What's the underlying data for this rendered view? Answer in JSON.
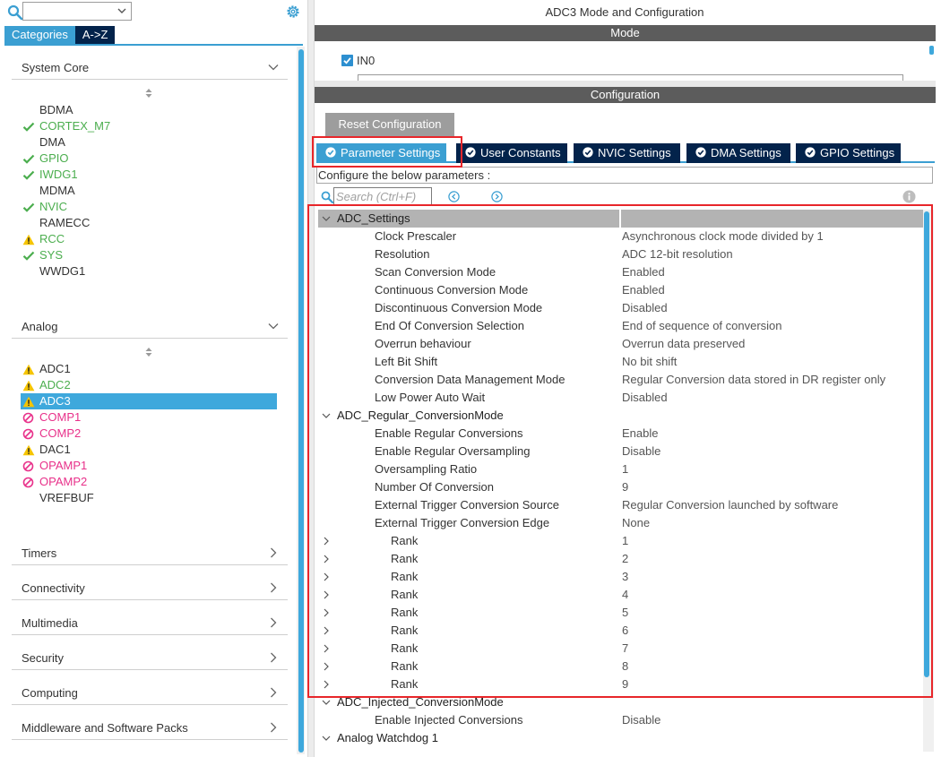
{
  "left_panel": {
    "search_icon": "search-icon",
    "combo_value": "",
    "gear_icon": "gear-icon",
    "tabs": [
      {
        "label": "Categories",
        "active": true
      },
      {
        "label": "A->Z",
        "active": false
      }
    ],
    "sections": [
      {
        "label": "System Core",
        "expanded": true,
        "items": [
          {
            "label": "BDMA",
            "status": "none"
          },
          {
            "label": "CORTEX_M7",
            "status": "ok"
          },
          {
            "label": "DMA",
            "status": "none"
          },
          {
            "label": "GPIO",
            "status": "ok"
          },
          {
            "label": "IWDG1",
            "status": "ok"
          },
          {
            "label": "MDMA",
            "status": "none"
          },
          {
            "label": "NVIC",
            "status": "ok"
          },
          {
            "label": "RAMECC",
            "status": "none"
          },
          {
            "label": "RCC",
            "status": "warning"
          },
          {
            "label": "SYS",
            "status": "ok"
          },
          {
            "label": "WWDG1",
            "status": "none"
          }
        ]
      },
      {
        "label": "Analog",
        "expanded": true,
        "items": [
          {
            "label": "ADC1",
            "status": "warning-text"
          },
          {
            "label": "ADC2",
            "status": "warning"
          },
          {
            "label": "ADC3",
            "status": "warning-selected"
          },
          {
            "label": "COMP1",
            "status": "disabled"
          },
          {
            "label": "COMP2",
            "status": "disabled"
          },
          {
            "label": "DAC1",
            "status": "warning-text"
          },
          {
            "label": "OPAMP1",
            "status": "disabled"
          },
          {
            "label": "OPAMP2",
            "status": "disabled"
          },
          {
            "label": "VREFBUF",
            "status": "none"
          }
        ]
      },
      {
        "label": "Timers",
        "expanded": false
      },
      {
        "label": "Connectivity",
        "expanded": false
      },
      {
        "label": "Multimedia",
        "expanded": false
      },
      {
        "label": "Security",
        "expanded": false
      },
      {
        "label": "Computing",
        "expanded": false
      },
      {
        "label": "Middleware and Software Packs",
        "expanded": false
      }
    ]
  },
  "right_panel": {
    "title": "ADC3 Mode and Configuration",
    "mode_bar": "Mode",
    "mode_checkbox_label": "IN0",
    "mode_checkbox_checked": true,
    "config_bar": "Configuration",
    "reset_button": "Reset Configuration",
    "tabs": [
      {
        "label": "Parameter Settings",
        "active": true
      },
      {
        "label": "User Constants",
        "active": false
      },
      {
        "label": "NVIC Settings",
        "active": false
      },
      {
        "label": "DMA Settings",
        "active": false
      },
      {
        "label": "GPIO Settings",
        "active": false
      }
    ],
    "configure_text": "Configure the below parameters :",
    "search_placeholder": "Search (Ctrl+F)",
    "rows": [
      {
        "type": "group",
        "name": "ADC_Settings",
        "expanded": true,
        "highlight": true
      },
      {
        "type": "param",
        "name": "Clock Prescaler",
        "value": "Asynchronous clock mode divided by 1"
      },
      {
        "type": "param",
        "name": "Resolution",
        "value": "ADC 12-bit resolution"
      },
      {
        "type": "param",
        "name": "Scan Conversion Mode",
        "value": "Enabled"
      },
      {
        "type": "param",
        "name": "Continuous Conversion Mode",
        "value": "Enabled"
      },
      {
        "type": "param",
        "name": "Discontinuous Conversion Mode",
        "value": "Disabled"
      },
      {
        "type": "param",
        "name": "End Of Conversion Selection",
        "value": "End of sequence of conversion"
      },
      {
        "type": "param",
        "name": "Overrun behaviour",
        "value": "Overrun data preserved"
      },
      {
        "type": "param",
        "name": "Left Bit Shift",
        "value": "No bit shift"
      },
      {
        "type": "param",
        "name": "Conversion Data Management Mode",
        "value": "Regular Conversion data stored in DR register only"
      },
      {
        "type": "param",
        "name": "Low Power Auto Wait",
        "value": "Disabled"
      },
      {
        "type": "group",
        "name": "ADC_Regular_ConversionMode",
        "expanded": true
      },
      {
        "type": "param",
        "name": "Enable Regular Conversions",
        "value": "Enable"
      },
      {
        "type": "param",
        "name": "Enable Regular Oversampling",
        "value": "Disable"
      },
      {
        "type": "param",
        "name": "Oversampling Ratio",
        "value": "1"
      },
      {
        "type": "param",
        "name": "Number Of Conversion",
        "value": "9"
      },
      {
        "type": "param",
        "name": "External Trigger Conversion Source",
        "value": "Regular Conversion launched by software"
      },
      {
        "type": "param",
        "name": "External Trigger Conversion Edge",
        "value": "None"
      },
      {
        "type": "rank",
        "name": "Rank",
        "value": "1"
      },
      {
        "type": "rank",
        "name": "Rank",
        "value": "2"
      },
      {
        "type": "rank",
        "name": "Rank",
        "value": "3"
      },
      {
        "type": "rank",
        "name": "Rank",
        "value": "4"
      },
      {
        "type": "rank",
        "name": "Rank",
        "value": "5"
      },
      {
        "type": "rank",
        "name": "Rank",
        "value": "6"
      },
      {
        "type": "rank",
        "name": "Rank",
        "value": "7"
      },
      {
        "type": "rank",
        "name": "Rank",
        "value": "8"
      },
      {
        "type": "rank",
        "name": "Rank",
        "value": "9"
      },
      {
        "type": "group",
        "name": "ADC_Injected_ConversionMode",
        "expanded": true
      },
      {
        "type": "param",
        "name": "Enable Injected Conversions",
        "value": "Disable"
      },
      {
        "type": "group",
        "name": "Analog Watchdog 1",
        "expanded": true
      }
    ]
  },
  "colors": {
    "accent_blue": "#3b9fd2",
    "navy": "#03234b",
    "ok_green": "#4cae4f",
    "warning_yellow": "#f5c400",
    "disabled_pink": "#e8318a",
    "annotation_red": "#e8262a"
  }
}
